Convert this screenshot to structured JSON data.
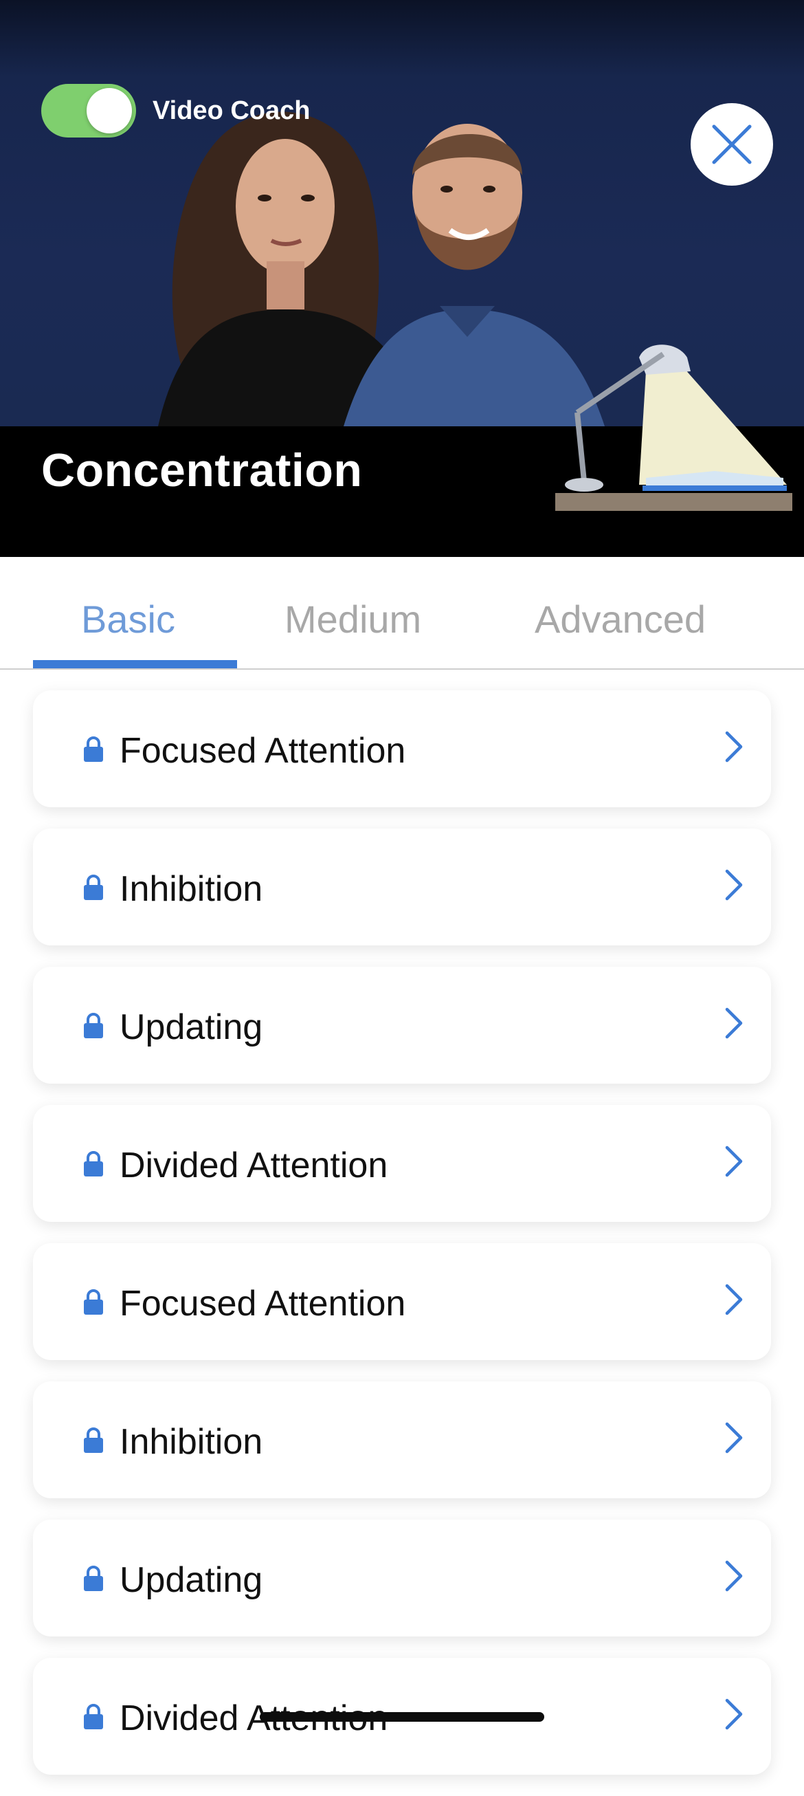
{
  "header": {
    "toggle_label": "Video Coach",
    "toggle_on": true,
    "title": "Concentration"
  },
  "tabs": [
    {
      "label": "Basic",
      "active": true
    },
    {
      "label": "Medium",
      "active": false
    },
    {
      "label": "Advanced",
      "active": false
    }
  ],
  "items": [
    {
      "label": "Focused Attention",
      "locked": true
    },
    {
      "label": "Inhibition",
      "locked": true
    },
    {
      "label": "Updating",
      "locked": true
    },
    {
      "label": "Divided Attention",
      "locked": true
    },
    {
      "label": "Focused Attention",
      "locked": true
    },
    {
      "label": "Inhibition",
      "locked": true
    },
    {
      "label": "Updating",
      "locked": true
    },
    {
      "label": "Divided Attention",
      "locked": true
    }
  ],
  "colors": {
    "accent": "#3b7bd6",
    "tab_active_text": "#6f9bd8",
    "tab_inactive_text": "#a8a8a8",
    "toggle_on": "#7fcf6e",
    "hero_bg": "#1b2a55"
  },
  "icons": {
    "toggle": "toggle-switch-icon",
    "close": "close-icon",
    "lock": "lock-icon",
    "chevron": "chevron-right-icon"
  }
}
